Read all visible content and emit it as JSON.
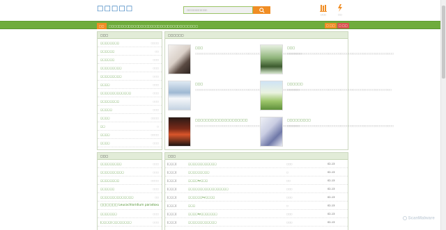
{
  "header": {
    "logo": "□□□□□",
    "search_placeholder": "□□□□□□□□□□□□",
    "icons": [
      {
        "name": "bookshelf-icon",
        "label": "□□□"
      },
      {
        "name": "history-icon",
        "label": "□□"
      }
    ]
  },
  "nav": {
    "items": [
      "□□",
      "□□□□",
      "□□□□",
      "□□□□",
      "□□□□",
      "□□□□",
      "□□□□",
      "□□□□",
      "□□□□",
      "□□□□"
    ],
    "login": "□ □□",
    "register": "□ □□"
  },
  "sidebar_top": {
    "title": "□□□",
    "rows": [
      {
        "t": "□□□□□□□□",
        "c": "□□□□"
      },
      {
        "t": "□□□□□□",
        "c": "□□"
      },
      {
        "t": "□□□□□□",
        "c": "□□□"
      },
      {
        "t": "□□□□□□□□□",
        "c": "□□□"
      },
      {
        "t": "□□□□□□□□□",
        "c": "□□□"
      },
      {
        "t": "□□□□",
        "c": "□□□"
      },
      {
        "t": "□□□□□□□□□□□□□",
        "c": "□□□"
      },
      {
        "t": "□□□□□□□□",
        "c": "□□□"
      },
      {
        "t": "□□□□□",
        "c": "□□□"
      },
      {
        "t": "□□□□",
        "c": "□□□□"
      },
      {
        "t": "□□",
        "c": "□"
      },
      {
        "t": "□□□□",
        "c": "□□□□"
      },
      {
        "t": "□□□□",
        "c": "□□□"
      }
    ]
  },
  "featured": {
    "title": "□□□□□□",
    "books": [
      {
        "title": "□□□",
        "desc": "□□□□□□□□□□□□□□□□□□□□□□□□□□□□□□□□□□□□□□□□□□□□□□□□□□□□□□"
      },
      {
        "title": "□□□",
        "desc": "□□□□□□□□□□□□□□□□□□□□□□□□□□□□□□□□□□□□□□□□□□□□□□□□□□□□□□"
      },
      {
        "title": "□□□",
        "desc": "□□□□□□□□□□□□□□□□□□□□□□□□□□□□□□□□□□□□□□□□□□□□□□□□□□□□□"
      },
      {
        "title": "□□□□□□",
        "desc": "□□□□□□□□□□□□□□□□□□□□□□□□□□□□□□□□□□□□□□□□□□□□□□□□□□□□□"
      },
      {
        "title": "□□□□□□□□□□□□□□□□□□□□",
        "desc": "□□□□□□□□□□□□□□□□□□□□□□□□□□□□□□□□□□□□□□□□□□□□□□□□□□□□□"
      },
      {
        "title": "□□□□□□□□□",
        "desc": "□□□□□□□□□□□□□□□□□□□□□□□□□□□□□□□□□□□□□□□□□□□□□□□□□□□□□□"
      }
    ]
  },
  "sidebar_bottom": {
    "title": "□□□",
    "rows": [
      {
        "t": "□□□□□□□□□",
        "c": "□□□"
      },
      {
        "t": "□□□□□□□□□□",
        "c": "□□□"
      },
      {
        "t": "□□□□□□□□",
        "c": "□□□□"
      },
      {
        "t": "□□□□□□",
        "c": "□□□"
      },
      {
        "t": "□□□□□□□□□□□□□□",
        "c": "□□"
      },
      {
        "t": "□□□□□□ Leucochloridium paradoxum",
        "c": ""
      },
      {
        "t": "□□□□□□□",
        "c": "□□□"
      },
      {
        "t": "[□□□□] □□□□□□□□",
        "c": "□□□"
      }
    ]
  },
  "updates": {
    "title": "□□□",
    "rows": [
      {
        "type": "[□□□]",
        "name": "□□□□□□□□□□□□",
        "author": "□□□",
        "date": "02-13"
      },
      {
        "type": "[□□□]",
        "name": "□□□□□□□□□",
        "author": "□",
        "date": "02-13"
      },
      {
        "type": "[□□□]",
        "name": "□□□□by□□□",
        "author": "□□",
        "date": "02-13"
      },
      {
        "type": "[□□□]",
        "name": "□□□□□□□□□□□□□□□□□",
        "author": "□□□",
        "date": "02-13"
      },
      {
        "type": "[□□□]",
        "name": "□□□□□□by□□□□",
        "author": "□□□",
        "date": "02-13"
      },
      {
        "type": "[□□□]",
        "name": "□□□",
        "author": "□",
        "date": "02-13"
      },
      {
        "type": "[□□□]",
        "name": "□□□□by□□□□□□□",
        "author": "□□□",
        "date": "02-13"
      },
      {
        "type": "[□□□]",
        "name": "□□□□□□□□□□□□",
        "author": "□□□",
        "date": "02-13"
      }
    ]
  },
  "watermark": "ScanMalware",
  "colors": {
    "accent": "#f08d24",
    "nav": "#6fac3c",
    "link": "#4a8f29",
    "logo": "#1a6ab3"
  }
}
